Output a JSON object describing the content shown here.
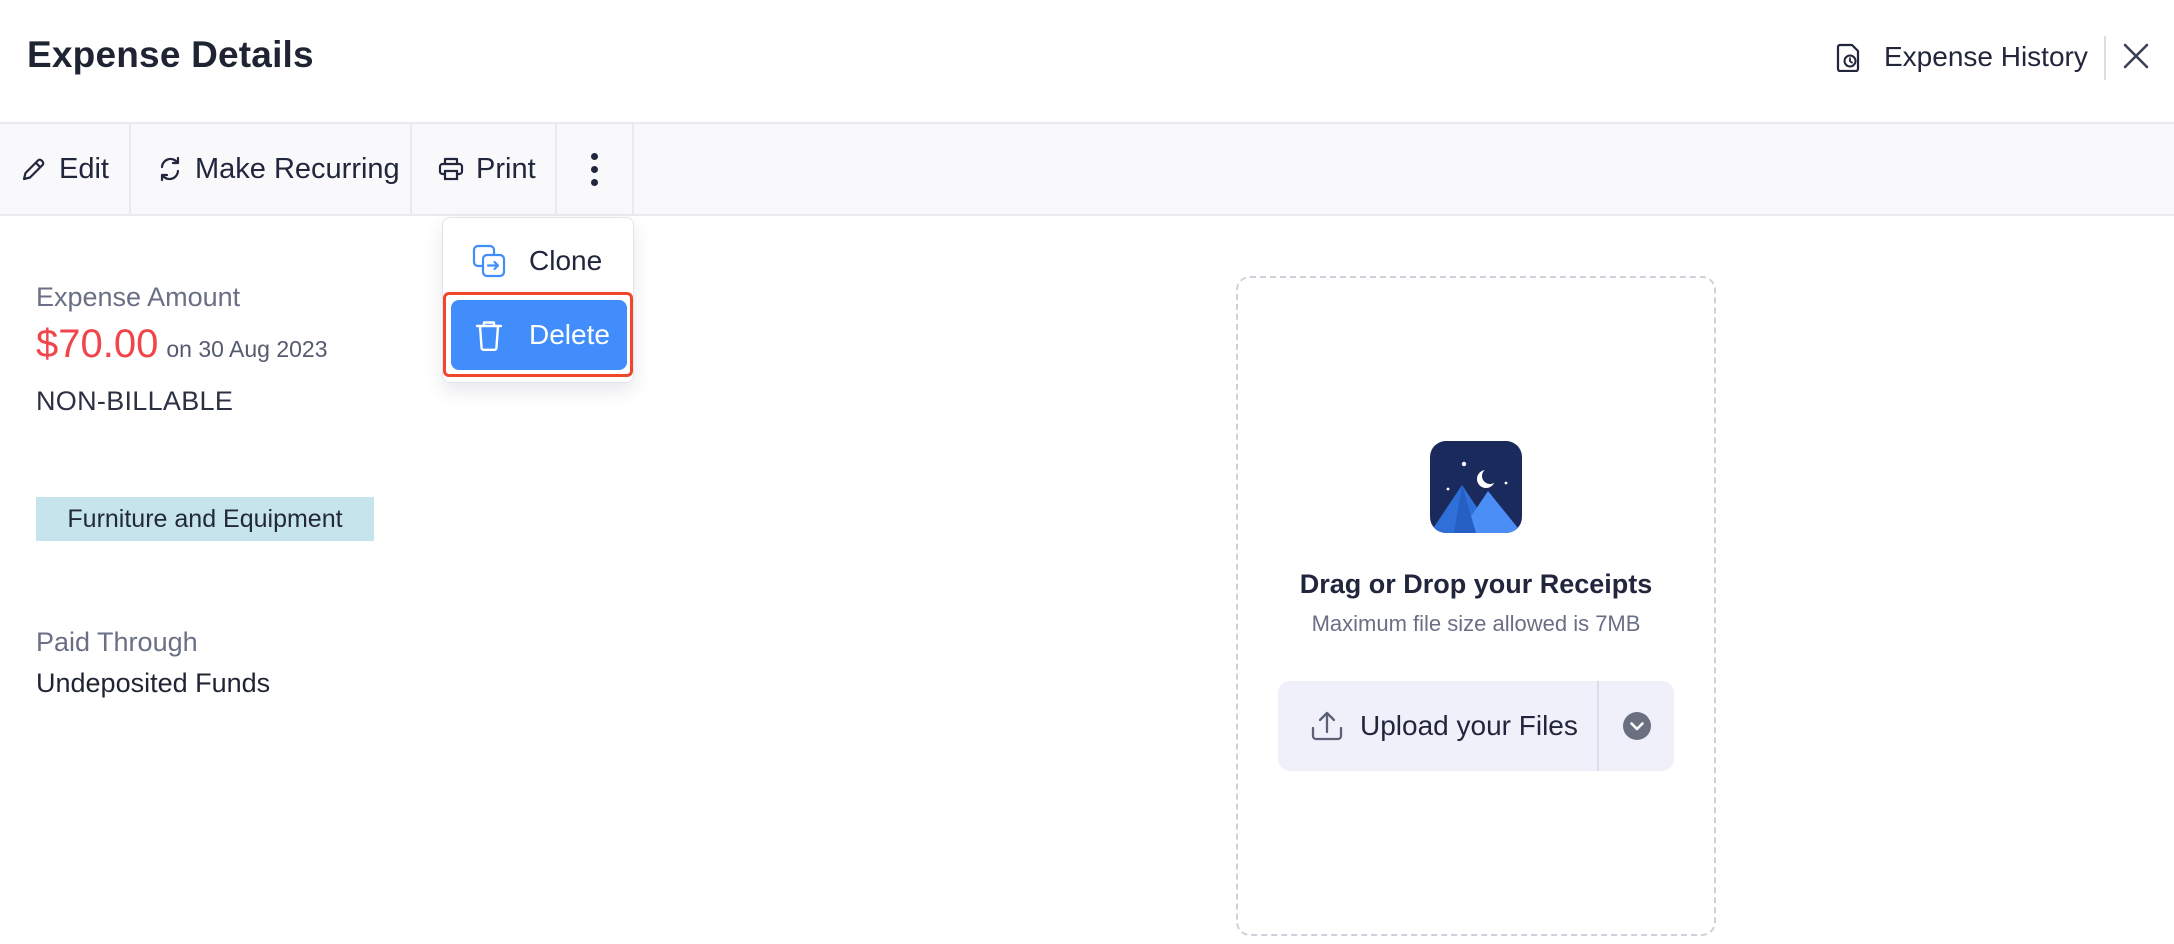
{
  "header": {
    "title": "Expense Details",
    "history_label": "Expense History",
    "history_icon": "history-icon",
    "close_icon": "close-icon"
  },
  "toolbar": {
    "edit_label": "Edit",
    "recurring_label": "Make Recurring",
    "print_label": "Print",
    "more_icon": "more-vertical-icon"
  },
  "menu": {
    "items": [
      {
        "label": "Clone",
        "icon": "clone-icon"
      },
      {
        "label": "Delete",
        "icon": "trash-icon",
        "highlighted": true
      }
    ]
  },
  "expense": {
    "amount_label": "Expense Amount",
    "amount": "$70.00",
    "date_text": "on 30 Aug 2023",
    "billable_status": "NON-BILLABLE",
    "category": "Furniture and Equipment",
    "paid_through_label": "Paid Through",
    "paid_through": "Undeposited Funds"
  },
  "upload": {
    "title": "Drag or Drop your Receipts",
    "subtitle": "Maximum file size allowed is 7MB",
    "button_label": "Upload your Files",
    "toggle_icon": "chevron-down-icon"
  },
  "colors": {
    "accent": "#408dfb",
    "amount": "#f0454b",
    "highlight_border": "#f0472c",
    "category_tag": "#c6e4ec"
  }
}
